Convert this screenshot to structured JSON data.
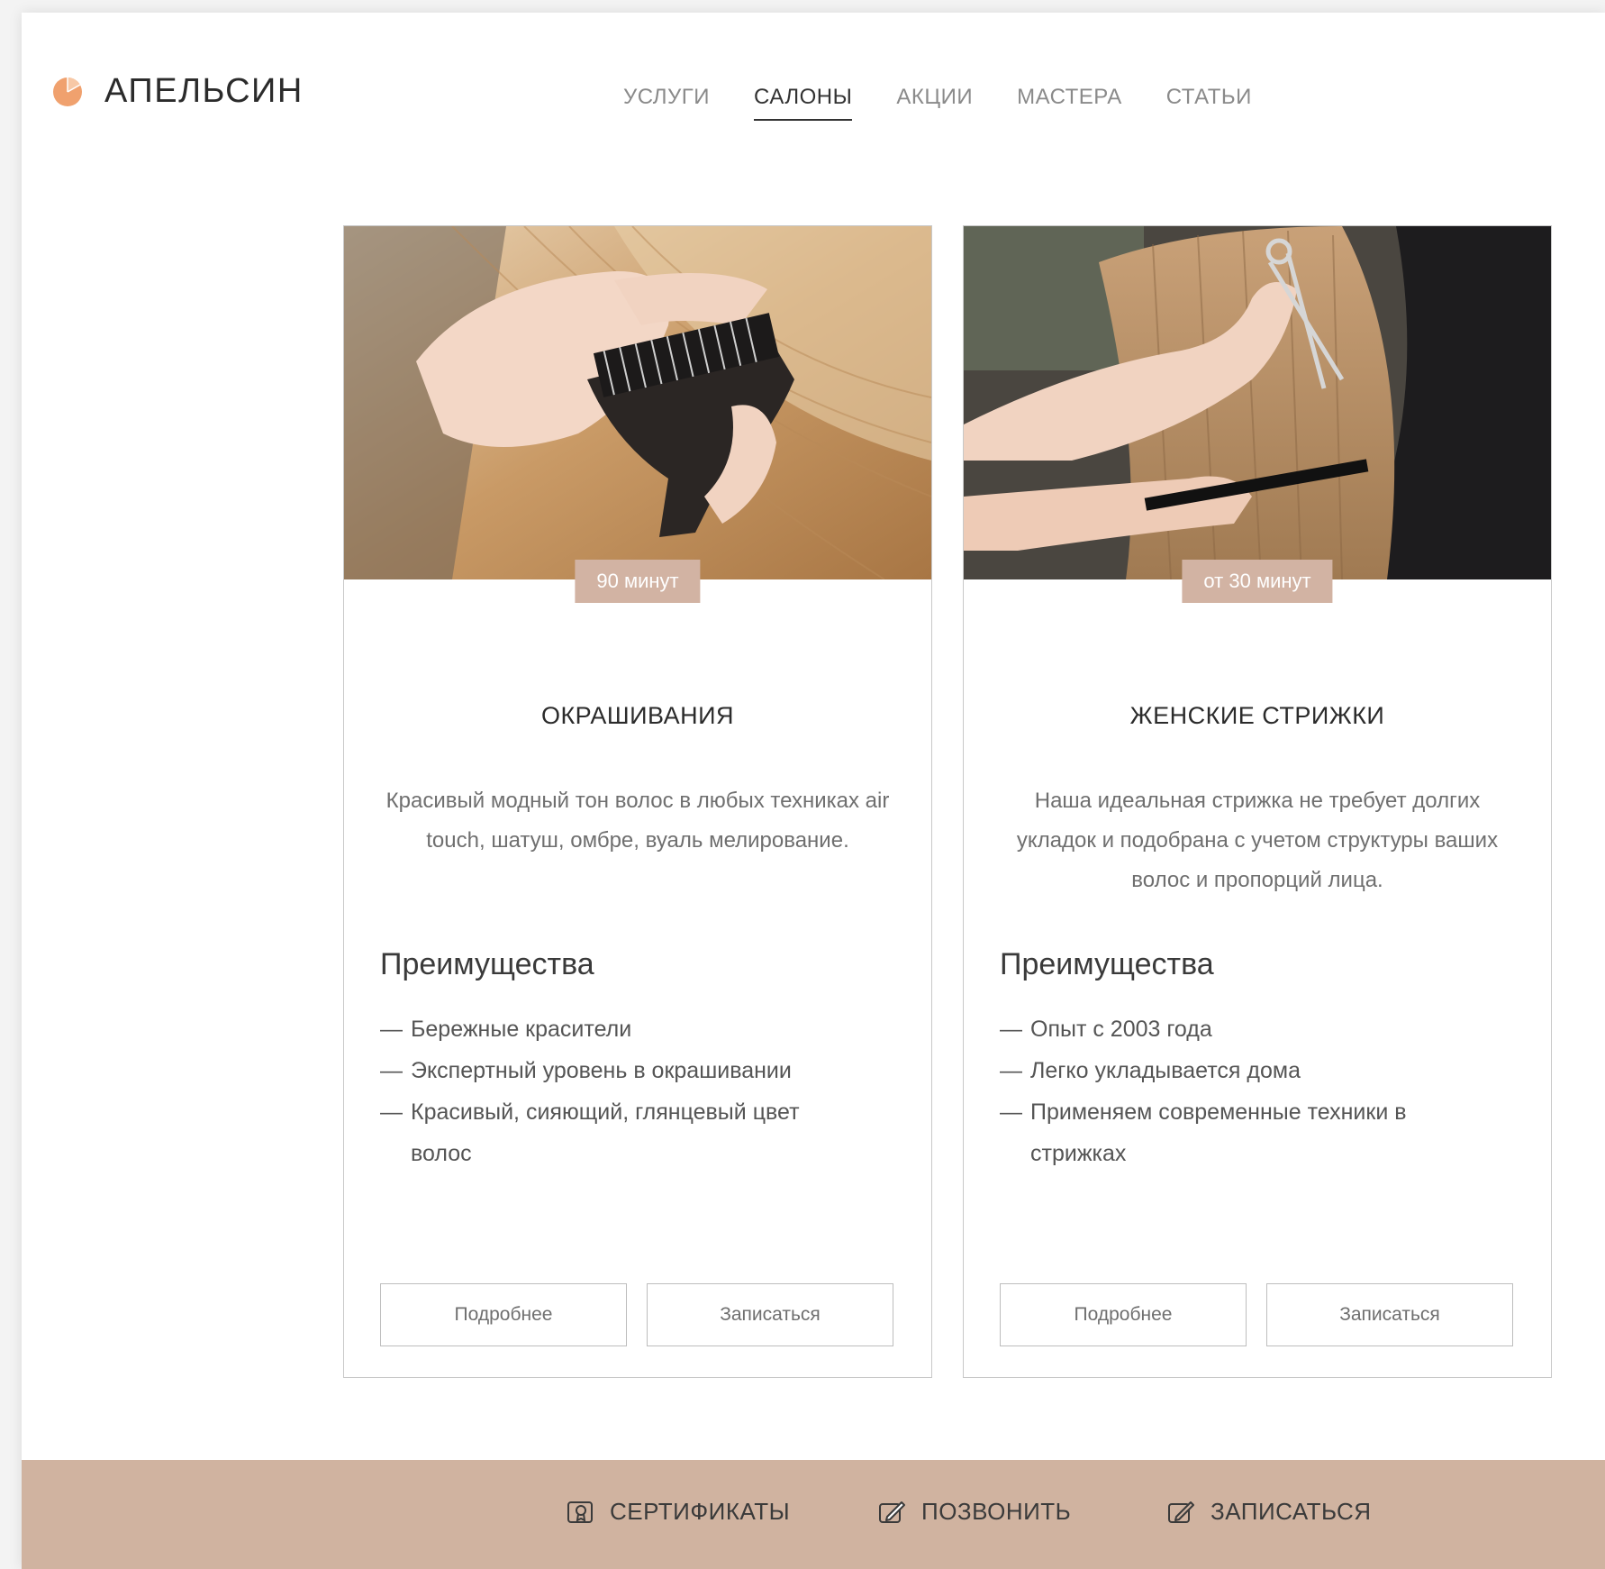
{
  "brand": {
    "name": "АПЕЛЬСИН",
    "logo_icon": "orange-slice-icon",
    "accent": "#f0a16e"
  },
  "nav": {
    "items": [
      {
        "label": "УСЛУГИ"
      },
      {
        "label": "САЛОНЫ",
        "active": true
      },
      {
        "label": "АКЦИИ"
      },
      {
        "label": "МАСТЕРА"
      },
      {
        "label": "СТАТЬИ"
      }
    ]
  },
  "cards": [
    {
      "duration": "90 минут",
      "title": "ОКРАШИВАНИЯ",
      "description": "Красивый модный тон волос в любых техниках air touch, шатуш, омбре, вуаль мелирование.",
      "benefits_heading": "Преимущества",
      "benefits": [
        "Бережные красители",
        "Экспертный уровень в окрашивании",
        "Красивый, сияющий, глянцевый цвет волос"
      ],
      "more_label": "Подробнее",
      "book_label": "Записаться"
    },
    {
      "duration": "от 30 минут",
      "title": "ЖЕНСКИЕ СТРИЖКИ",
      "description": "Наша идеальная стрижка не требует долгих укладок и подобрана с учетом структуры ваших волос и пропорций лица.",
      "benefits_heading": "Преимущества",
      "benefits": [
        "Опыт с 2003 года",
        "Легко укладывается дома",
        "Применяем современные техники в стрижках"
      ],
      "more_label": "Подробнее",
      "book_label": "Записаться"
    }
  ],
  "footer": {
    "certificates": {
      "label": "СЕРТИФИКАТЫ",
      "icon": "certificate-icon"
    },
    "call": {
      "label": "ПОЗВОНИТЬ",
      "icon": "phone-edit-icon"
    },
    "book": {
      "label": "ЗАПИСАТЬСЯ",
      "icon": "edit-pen-icon"
    }
  },
  "colors": {
    "badge": "#d2b3a3",
    "footer": "#d0b3a0",
    "text": "#2b2b2b"
  }
}
